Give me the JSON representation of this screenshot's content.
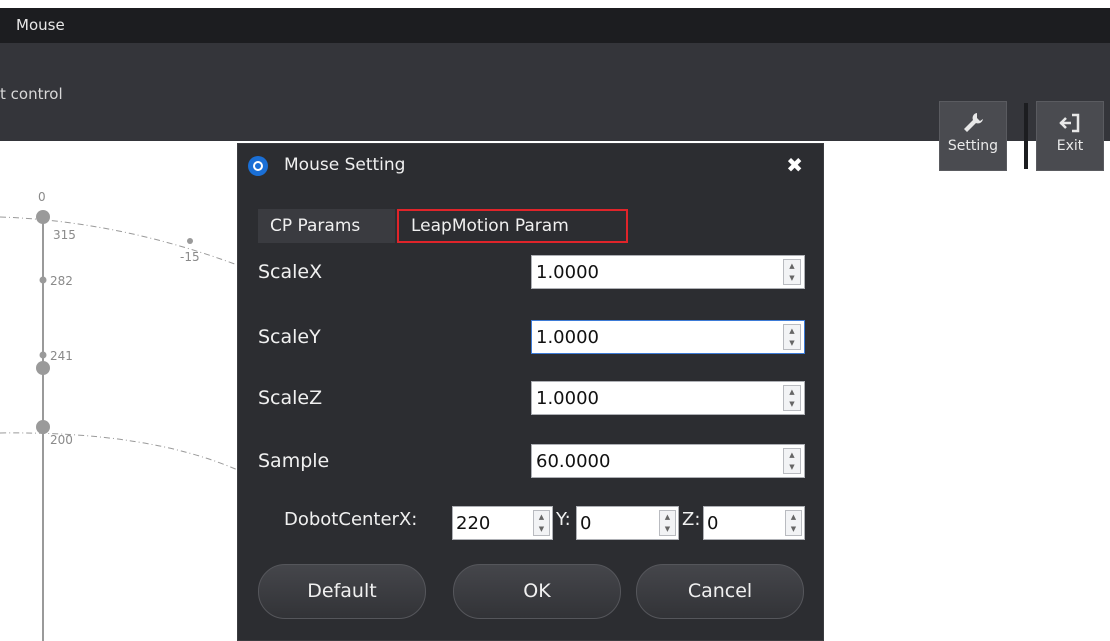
{
  "app": {
    "window_title": "Mouse",
    "mode_text": "t control",
    "toolbar": {
      "setting_label": "Setting",
      "exit_label": "Exit"
    }
  },
  "plot": {
    "labels": [
      "0",
      "315",
      "-15",
      "282",
      "241",
      "200"
    ]
  },
  "dialog": {
    "title": "Mouse Setting",
    "close_glyph": "✖",
    "tabs": [
      {
        "label": "CP Params",
        "active": false
      },
      {
        "label": "LeapMotion Param",
        "active": true
      }
    ],
    "fields": [
      {
        "label": "ScaleX",
        "value": "1.0000"
      },
      {
        "label": "ScaleY",
        "value": "1.0000"
      },
      {
        "label": "ScaleZ",
        "value": "1.0000"
      },
      {
        "label": "Sample",
        "value": "60.0000"
      }
    ],
    "dobot_center": {
      "label": "DobotCenter",
      "x_label": "X:",
      "x_value": "220",
      "y_label": "Y:",
      "y_value": "0",
      "z_label": "Z:",
      "z_value": "0"
    },
    "buttons": {
      "default": "Default",
      "ok": "OK",
      "cancel": "Cancel"
    }
  },
  "colors": {
    "highlight_border": "#e0242a",
    "dialog_bg": "#2c2d31",
    "titlebar_bg": "#1c1d20"
  }
}
